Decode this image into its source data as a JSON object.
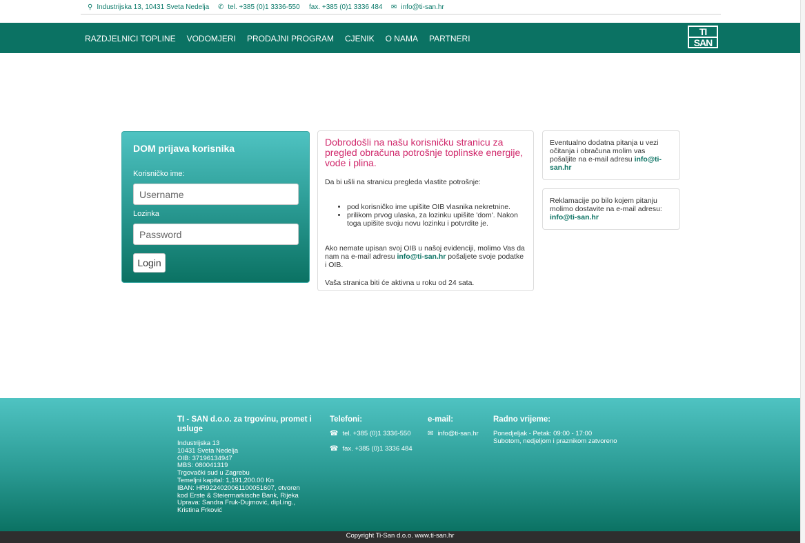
{
  "topbar": {
    "address": "Industrijska 13, 10431 Sveta Nedelja",
    "phone": "tel. +385 (0)1 3336-550",
    "fax": "fax. +385 (0)1 3336 484",
    "email": "info@ti-san.hr",
    "icons": [
      "map-pin-icon",
      "phone-icon",
      "mail-icon"
    ]
  },
  "nav": {
    "items": [
      "RAZDJELNICI TOPLINE",
      "VODOMJERI",
      "PRODAJNI PROGRAM",
      "CJENIK",
      "O NAMA",
      "PARTNERI"
    ],
    "logo_top": "TI",
    "logo_bottom": "SAN"
  },
  "login": {
    "title": "DOM prijava korisnika",
    "username_label": "Korisničko ime:",
    "username_placeholder": "Username",
    "password_label": "Lozinka",
    "password_placeholder": "Password",
    "button": "Login"
  },
  "welcome": {
    "heading": "Dobrodošli na našu korisničku stranicu za pregled obračuna potrošnje toplinske energije, vode i plina.",
    "intro": "Da bi ušli na stranicu pregleda vlastite potrošnje:",
    "bullets": [
      "pod korisničko ime upišite OIB vlasnika nekretnine.",
      "prilikom prvog ulaska, za lozinku upišite 'dom'. Nakon toga upišite svoju novu lozinku i potvrdite je."
    ],
    "p2_before": "Ako nemate upisan svoj OIB u našoj evidenciji, molimo Vas da nam na e-mail adresu ",
    "p2_email": "info@ti-san.hr",
    "p2_after": " pošaljete svoje podatke i OIB.",
    "p3": "Vaša stranica biti će aktivna u roku od 24 sata."
  },
  "info1": {
    "text": "Eventualno dodatna pitanja u vezi očitanja i obračuna molim vas pošaljite na e-mail adresu ",
    "email": "info@ti-san.hr"
  },
  "info2": {
    "text": "Reklamacije po bilo kojem pitanju molimo dostavite na e-mail adresu: ",
    "email": "info@ti-san.hr"
  },
  "footer": {
    "company_title": "TI - SAN d.o.o. za trgovinu, promet i usluge",
    "company_lines": [
      "Industrijska 13",
      "10431 Sveta Nedelja",
      "OIB: 37196134947",
      "MBS: 080041319",
      "Trgovački sud u Zagrebu",
      "Temeljni kapital: 1,191,200.00 Kn",
      "IBAN: HR9224020061100051607, otvoren",
      "kod Erste & Steiermarkische Bank, Rijeka",
      "Uprava: Sandra Fruk-Dujmović, dipl.ing.,",
      "Kristina Frković"
    ],
    "phones_title": "Telefoni:",
    "phone": "tel. +385 (0)1 3336-550",
    "fax": "fax. +385 (0)1 3336 484",
    "email_title": "e-mail:",
    "email": "info@ti-san.hr",
    "hours_title": "Radno vrijeme:",
    "hours_lines": [
      "Ponedjeljak - Petak: 09:00 - 17:00",
      "Subotom, nedjeljom i praznikom zatvoreno"
    ],
    "copyright": "Copyright Ti-San d.o.o. www.ti-san.hr"
  }
}
